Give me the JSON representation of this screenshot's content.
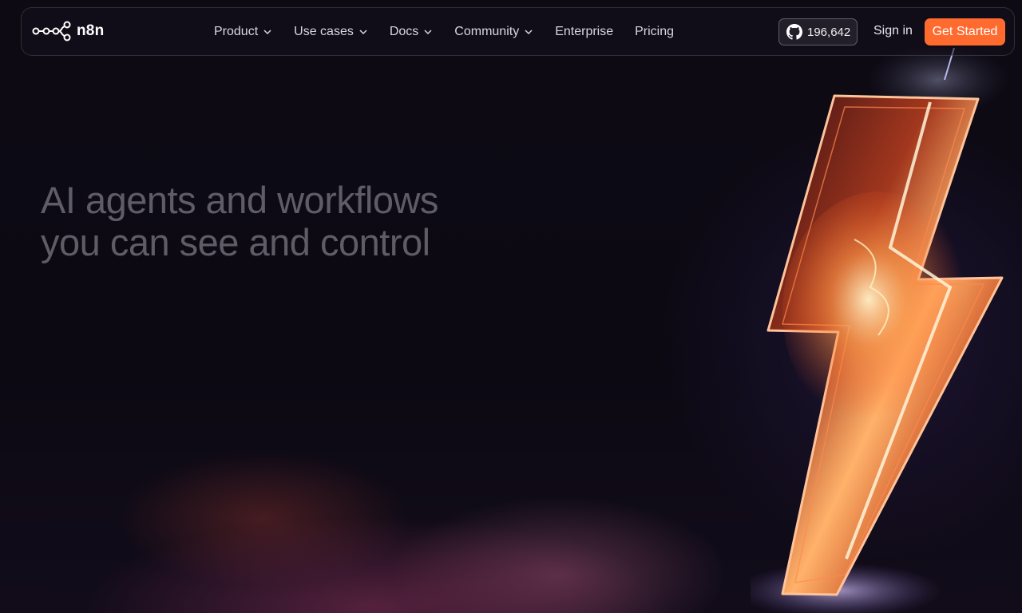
{
  "brand": {
    "name": "n8n",
    "icon": "n8n-logo-icon"
  },
  "nav": {
    "items": [
      {
        "label": "Product",
        "has_dropdown": true
      },
      {
        "label": "Use cases",
        "has_dropdown": true
      },
      {
        "label": "Docs",
        "has_dropdown": true
      },
      {
        "label": "Community",
        "has_dropdown": true
      },
      {
        "label": "Enterprise",
        "has_dropdown": false
      },
      {
        "label": "Pricing",
        "has_dropdown": false
      }
    ]
  },
  "github": {
    "icon": "github-icon",
    "stars": "196,642"
  },
  "auth": {
    "signin_label": "Sign in",
    "cta_label": "Get Started"
  },
  "hero": {
    "line1": "AI agents and workflows",
    "line2": "you can see and control"
  },
  "colors": {
    "accent": "#ff6a2f",
    "background": "#0e0b16",
    "hero_text": "#5f5c68"
  }
}
